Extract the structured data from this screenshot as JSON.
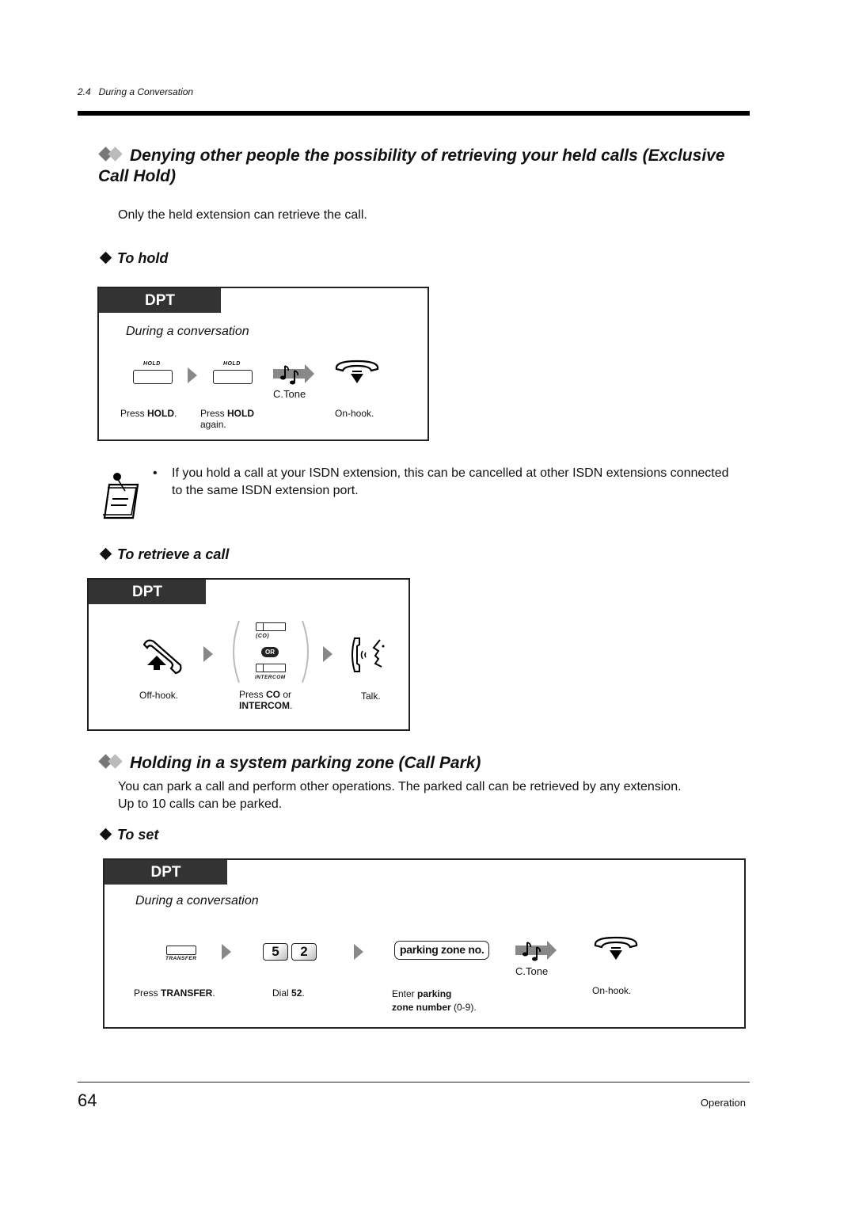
{
  "header": {
    "section": "2.4   During a Conversation"
  },
  "exclusive_hold": {
    "title_line1": "Denying other people the possibility of retrieving your held calls (Exclusive",
    "title_line2": "Call Hold)",
    "intro": "Only the held extension can retrieve the call.",
    "to_hold": {
      "heading": "To hold",
      "badge": "DPT",
      "context": "During a conversation",
      "steps": [
        {
          "key_label": "HOLD",
          "caption_pre": "Press ",
          "caption_bold": "HOLD",
          "caption_post": "."
        },
        {
          "key_label": "HOLD",
          "caption_pre": "Press ",
          "caption_bold": "HOLD",
          "caption_post": "",
          "caption_line2": "again."
        },
        {
          "tone_label": "C.Tone"
        },
        {
          "caption": "On-hook."
        }
      ]
    },
    "note": "If you hold a call at your ISDN extension, this can be cancelled at other ISDN extensions connected to the same ISDN extension port.",
    "to_retrieve": {
      "heading": "To retrieve a call",
      "badge": "DPT",
      "steps": [
        {
          "caption": "Off-hook."
        },
        {
          "key1_label": "(CO)",
          "or_label": "OR",
          "key2_label": "INTERCOM",
          "caption_pre": "Press ",
          "caption_bold": "CO",
          "caption_post": " or",
          "caption_line2_bold": "INTERCOM",
          "caption_line2_post": "."
        },
        {
          "caption": "Talk."
        }
      ]
    }
  },
  "call_park": {
    "title": "Holding in a system parking zone (Call Park)",
    "intro_line1": "You can park a call and perform other operations. The parked call can be retrieved by any extension.",
    "intro_line2": "Up to 10 calls can be parked.",
    "to_set": {
      "heading": "To set",
      "badge": "DPT",
      "context": "During a conversation",
      "steps": [
        {
          "key_label": "TRANSFER",
          "caption_pre": "Press ",
          "caption_bold": "TRANSFER",
          "caption_post": "."
        },
        {
          "digits": [
            "5",
            "2"
          ],
          "caption_pre": "Dial ",
          "caption_bold": "52",
          "caption_post": "."
        },
        {
          "pill": "parking zone no.",
          "caption_pre": "Enter ",
          "caption_bold": "parking",
          "caption_line2_bold": "zone number",
          "caption_line2_post": " (0-9)."
        },
        {
          "tone_label": "C.Tone"
        },
        {
          "caption": "On-hook."
        }
      ]
    }
  },
  "footer": {
    "page_number": "64",
    "chapter": "Operation"
  }
}
